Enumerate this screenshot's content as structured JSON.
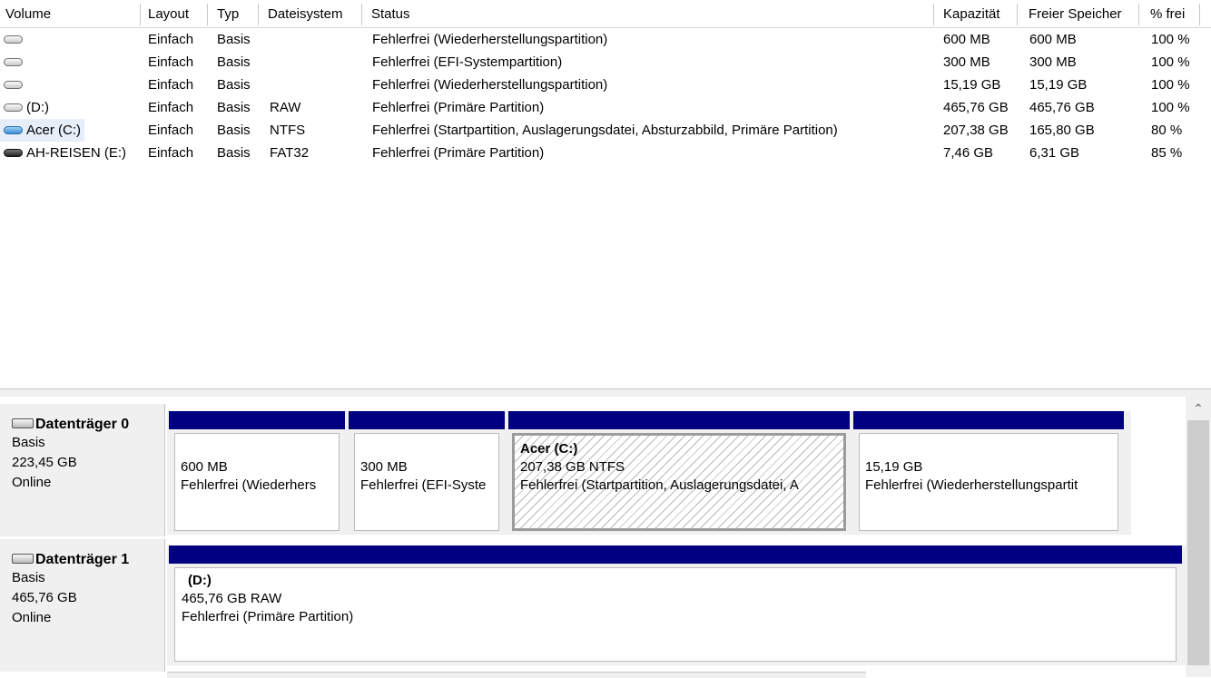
{
  "columns": [
    "Volume",
    "Layout",
    "Typ",
    "Dateisystem",
    "Status",
    "Kapazität",
    "Freier Speicher",
    "% frei"
  ],
  "volumes": [
    {
      "icon": "drive-icon",
      "name": "",
      "layout": "Einfach",
      "type": "Basis",
      "fs": "",
      "status": "Fehlerfrei (Wiederherstellungspartition)",
      "capacity": "600 MB",
      "free": "600 MB",
      "pct": "100 %"
    },
    {
      "icon": "drive-icon",
      "name": "",
      "layout": "Einfach",
      "type": "Basis",
      "fs": "",
      "status": "Fehlerfrei (EFI-Systempartition)",
      "capacity": "300 MB",
      "free": "300 MB",
      "pct": "100 %"
    },
    {
      "icon": "drive-icon",
      "name": "",
      "layout": "Einfach",
      "type": "Basis",
      "fs": "",
      "status": "Fehlerfrei (Wiederherstellungspartition)",
      "capacity": "15,19 GB",
      "free": "15,19 GB",
      "pct": "100 %"
    },
    {
      "icon": "drive-icon",
      "name": "(D:)",
      "layout": "Einfach",
      "type": "Basis",
      "fs": "RAW",
      "status": "Fehlerfrei (Primäre Partition)",
      "capacity": "465,76 GB",
      "free": "465,76 GB",
      "pct": "100 %"
    },
    {
      "icon": "system-drive-icon",
      "name": "Acer (C:)",
      "layout": "Einfach",
      "type": "Basis",
      "fs": "NTFS",
      "status": "Fehlerfrei (Startpartition, Auslagerungsdatei, Absturzabbild, Primäre Partition)",
      "capacity": "207,38 GB",
      "free": "165,80 GB",
      "pct": "80 %"
    },
    {
      "icon": "usb-drive-icon",
      "name": "AH-REISEN (E:)",
      "layout": "Einfach",
      "type": "Basis",
      "fs": "FAT32",
      "status": "Fehlerfrei (Primäre Partition)",
      "capacity": "7,46 GB",
      "free": "6,31 GB",
      "pct": "85 %"
    }
  ],
  "disks": [
    {
      "name": "Datenträger 0",
      "type": "Basis",
      "size": "223,45 GB",
      "state": "Online",
      "partitions": [
        {
          "name": "",
          "size": "600 MB",
          "status": "Fehlerfrei (Wiederhers"
        },
        {
          "name": "",
          "size": "300 MB",
          "status": "Fehlerfrei (EFI-Syste"
        },
        {
          "name": "Acer  (C:)",
          "size": "207,38 GB NTFS",
          "status": "Fehlerfrei (Startpartition, Auslagerungsdatei, A"
        },
        {
          "name": "",
          "size": "15,19 GB",
          "status": "Fehlerfrei (Wiederherstellungspartit"
        }
      ]
    },
    {
      "name": "Datenträger 1",
      "type": "Basis",
      "size": "465,76 GB",
      "state": "Online",
      "partitions": [
        {
          "name": "(D:)",
          "size": "465,76 GB RAW",
          "status": "Fehlerfrei (Primäre Partition)"
        }
      ]
    }
  ],
  "colors": {
    "partition_bar": "#000080",
    "selected_row": "#e5eef9",
    "panel_bg": "#f0f0f0"
  }
}
